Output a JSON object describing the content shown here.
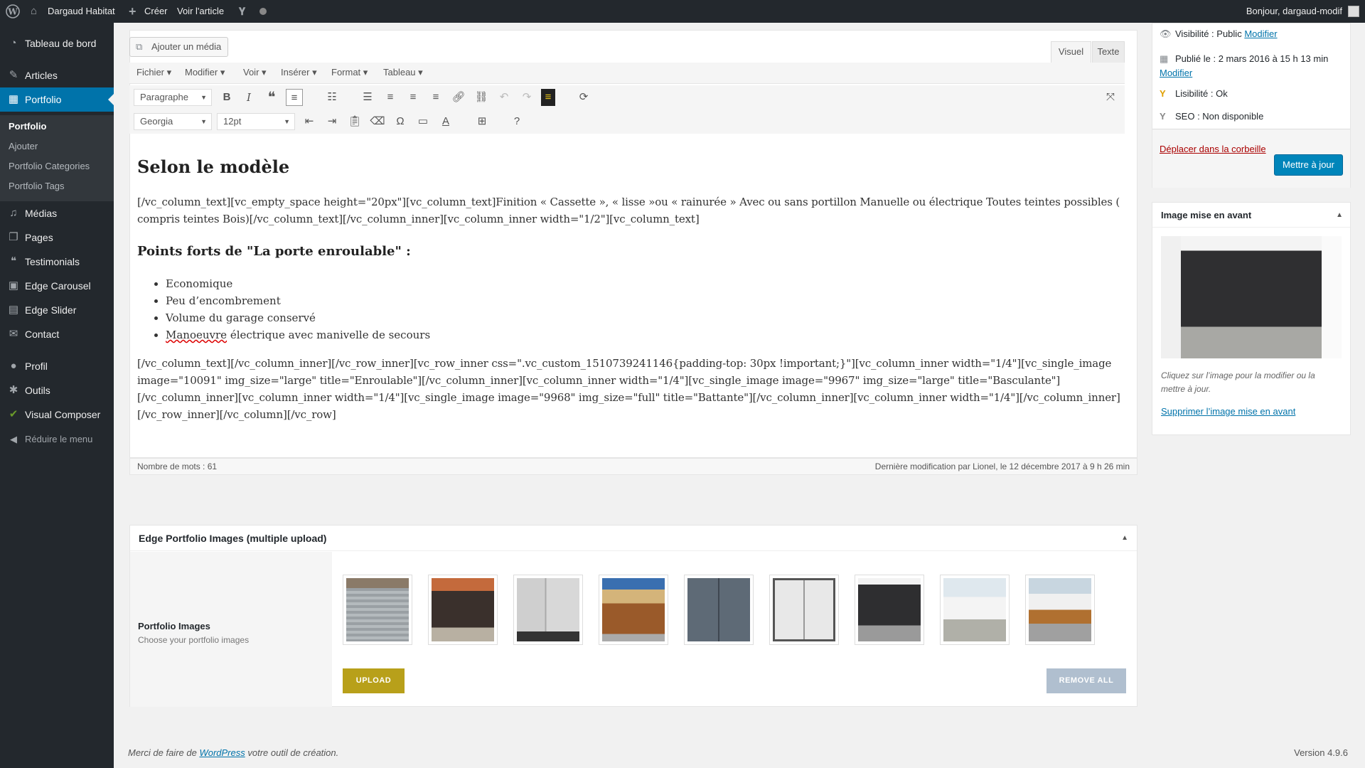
{
  "adminbar": {
    "site_name": "Dargaud Habitat",
    "create_label": "Créer",
    "view_article": "Voir l'article",
    "greeting": "Bonjour, dargaud-modif"
  },
  "sidebar": {
    "items": [
      {
        "label": "Tableau de bord",
        "icon": "dashboard-icon"
      },
      {
        "label": "Articles",
        "icon": "pin-icon"
      },
      {
        "label": "Portfolio",
        "icon": "grid-icon"
      },
      {
        "label": "Médias",
        "icon": "media-icon"
      },
      {
        "label": "Pages",
        "icon": "pages-icon"
      },
      {
        "label": "Testimonials",
        "icon": "quote-icon"
      },
      {
        "label": "Edge Carousel",
        "icon": "carousel-icon"
      },
      {
        "label": "Edge Slider",
        "icon": "slider-icon"
      },
      {
        "label": "Contact",
        "icon": "mail-icon"
      },
      {
        "label": "Profil",
        "icon": "user-icon"
      },
      {
        "label": "Outils",
        "icon": "wrench-icon"
      },
      {
        "label": "Visual Composer",
        "icon": "vc-icon"
      }
    ],
    "submenu": [
      "Portfolio",
      "Ajouter",
      "Portfolio Categories",
      "Portfolio Tags"
    ],
    "collapse_label": "Réduire le menu"
  },
  "editor": {
    "add_media": "Ajouter un média",
    "tab_visual": "Visuel",
    "tab_text": "Texte",
    "menubar": [
      "Fichier",
      "Modifier",
      "Voir",
      "Insérer",
      "Format",
      "Tableau"
    ],
    "format_select": "Paragraphe",
    "font_select": "Georgia",
    "size_select": "12pt",
    "heading1": "Selon le modèle",
    "para1": "[/vc_column_text][vc_empty_space height=\"20px\"][vc_column_text]Finition « Cassette », « lisse »ou « rainurée » Avec ou sans portillon Manuelle ou électrique Toutes teintes possibles ( compris teintes Bois)[/vc_column_text][/vc_column_inner][vc_column_inner width=\"1/2\"][vc_column_text]",
    "heading2": "Points forts de \"La porte enroulable\" :",
    "bullets": [
      "Economique",
      "Peu d’encombrement",
      "Volume du garage conservé"
    ],
    "bullet4_misspelled": "Manoeuvre",
    "bullet4_rest": " électrique avec manivelle de secours",
    "para2": "[/vc_column_text][/vc_column_inner][/vc_row_inner][vc_row_inner css=\".vc_custom_1510739241146{padding-top: 30px !important;}\"][vc_column_inner width=\"1/4\"][vc_single_image image=\"10091\" img_size=\"large\" title=\"Enroulable\"][/vc_column_inner][vc_column_inner width=\"1/4\"][vc_single_image image=\"9967\" img_size=\"large\" title=\"Basculante\"][/vc_column_inner][vc_column_inner width=\"1/4\"][vc_single_image image=\"9968\" img_size=\"full\" title=\"Battante\"][/vc_column_inner][vc_column_inner width=\"1/4\"][/vc_column_inner][/vc_row_inner][/vc_column][/vc_row]",
    "word_count": "Nombre de mots : 61",
    "last_modified": "Dernière modification par Lionel, le 12 décembre 2017 à 9 h 26 min"
  },
  "portfolio_box": {
    "title": "Edge Portfolio Images (multiple upload)",
    "label": "Portfolio Images",
    "description": "Choose your portfolio images",
    "upload": "UPLOAD",
    "remove_all": "REMOVE ALL"
  },
  "publish": {
    "visibility_label": "Visibilité : Public",
    "visibility_link": "Modifier",
    "published_label": "Publié le : 2 mars 2016 à 15 h 13 min",
    "published_link": "Modifier",
    "readability": "Lisibilité : Ok",
    "seo": "SEO : Non disponible",
    "trash": "Déplacer dans la corbeille",
    "update": "Mettre à jour"
  },
  "featured": {
    "title": "Image mise en avant",
    "hint": "Cliquez sur l’image pour la modifier ou la mettre à jour.",
    "remove": "Supprimer l’image mise en avant"
  },
  "footer": {
    "thanks_pre": "Merci de faire de ",
    "wordpress": "WordPress",
    "thanks_post": " votre outil de création.",
    "version": "Version 4.9.6"
  },
  "colors": {
    "accent": "#0073aa",
    "upload_button": "#b8a01a",
    "remove_button": "#b0bfcf"
  }
}
